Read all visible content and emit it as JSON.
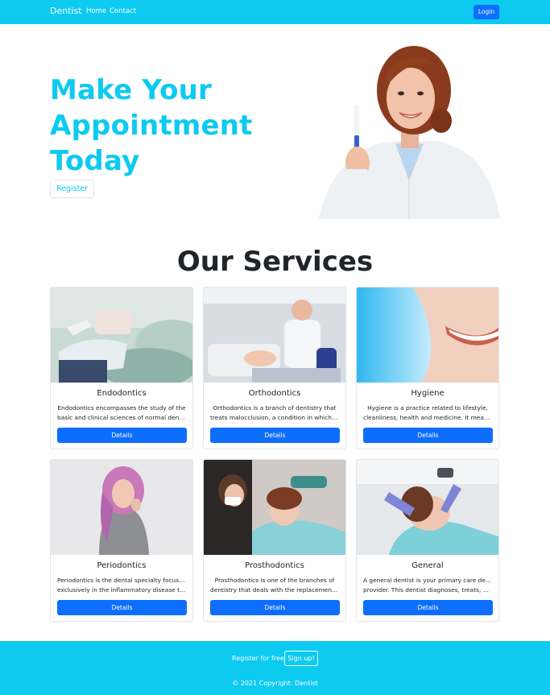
{
  "navbar": {
    "brand": "Dentist",
    "links": [
      "Home",
      "Contact"
    ],
    "login": "Login"
  },
  "hero": {
    "title_lines": [
      "Make Your",
      "Appointment",
      "Today"
    ],
    "register": "Register"
  },
  "services": {
    "title": "Our Services",
    "cards": [
      {
        "title": "Endodontics",
        "text_lines": [
          "Endodontics encompasses the study of the",
          "basic and clinical sciences of normal dental..."
        ],
        "button": "Details"
      },
      {
        "title": "Orthodontics",
        "text_lines": [
          "Orthodontics is a branch of dentistry that",
          "treats malocclusion, a condition in which th..."
        ],
        "button": "Details"
      },
      {
        "title": "Hygiene",
        "text_lines": [
          "Hygiene is a practice related to lifestyle,",
          "cleanliness, health and medicine. It means..."
        ],
        "button": "Details"
      },
      {
        "title": "Periodontics",
        "text_lines": [
          "Periodontics is the dental specialty focusing",
          "exclusively in the inflammatory disease tha..."
        ],
        "button": "Details"
      },
      {
        "title": "Prosthodontics",
        "text_lines": [
          "Prosthodontics is one of the branches of",
          "dentistry that deals with the replacement o..."
        ],
        "button": "Details"
      },
      {
        "title": "General",
        "text_lines": [
          "A general dentist is your primary care dental",
          "provider. This dentist diagnoses, treats, an..."
        ],
        "button": "Details"
      }
    ]
  },
  "footer": {
    "register_text": "Register for free",
    "signup": "Sign up!",
    "copyright": "© 2021 Copyright: Dentist"
  },
  "colors": {
    "accent": "#0dcaf0",
    "primary": "#0d6efd"
  }
}
